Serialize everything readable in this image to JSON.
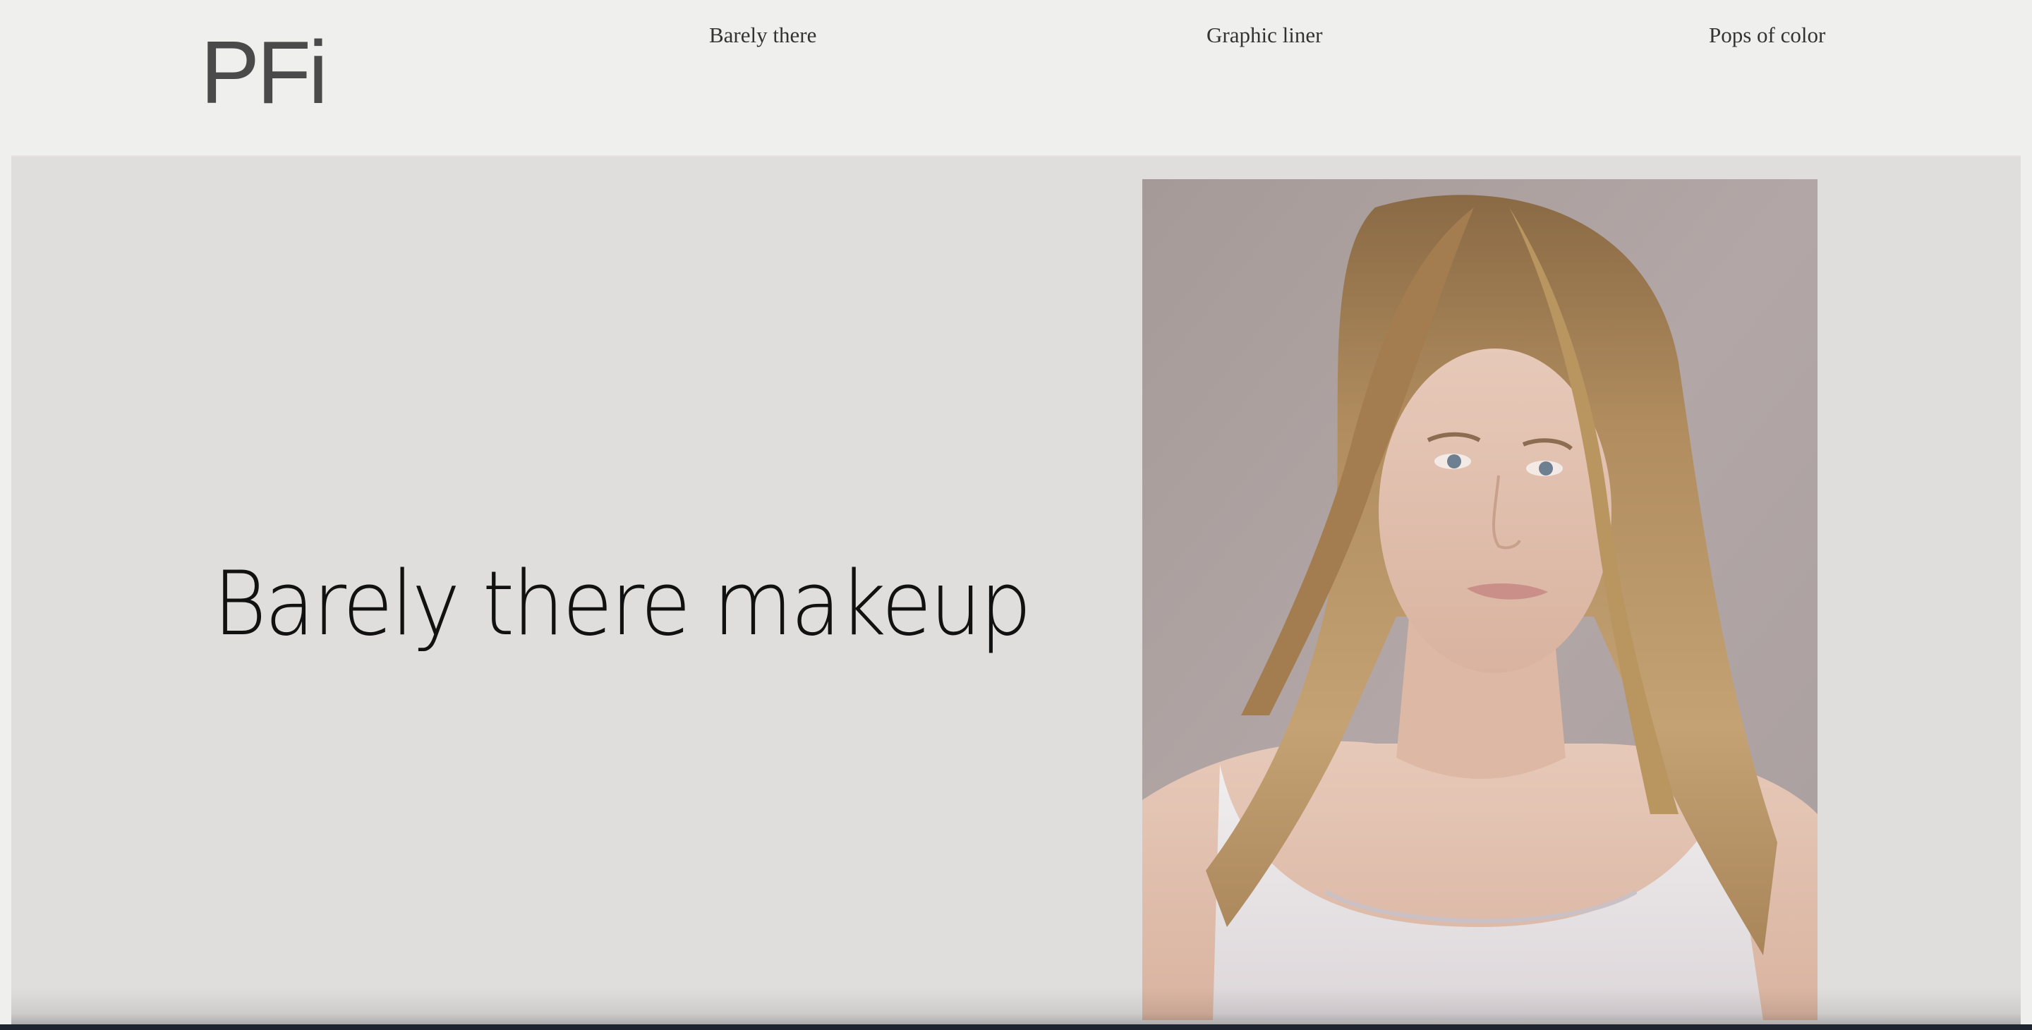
{
  "header": {
    "logo": "PFi",
    "nav": [
      {
        "label": "Barely there"
      },
      {
        "label": "Graphic liner"
      },
      {
        "label": "Pops of color"
      }
    ]
  },
  "hero": {
    "title": "Barely there makeup",
    "image_alt": "portrait-photo"
  },
  "colors": {
    "page_bg": "#efefed",
    "hero_bg": "#dfdedd",
    "logo": "#4a4a4a",
    "title": "#111111"
  }
}
